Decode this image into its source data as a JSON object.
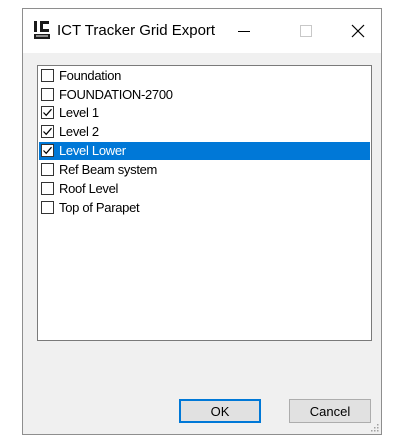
{
  "window": {
    "title": "ICT Tracker Grid Export",
    "icon": "ict-logo-icon"
  },
  "title_controls": {
    "minimize": "minimize-icon",
    "maximize": "maximize-icon",
    "close": "close-icon"
  },
  "levels": [
    {
      "label": "Foundation",
      "checked": false,
      "selected": false
    },
    {
      "label": "FOUNDATION-2700",
      "checked": false,
      "selected": false
    },
    {
      "label": "Level 1",
      "checked": true,
      "selected": false
    },
    {
      "label": "Level 2",
      "checked": true,
      "selected": false
    },
    {
      "label": "Level Lower",
      "checked": true,
      "selected": true
    },
    {
      "label": "Ref Beam system",
      "checked": false,
      "selected": false
    },
    {
      "label": "Roof Level",
      "checked": false,
      "selected": false
    },
    {
      "label": "Top of Parapet",
      "checked": false,
      "selected": false
    }
  ],
  "buttons": {
    "ok_label": "OK",
    "cancel_label": "Cancel"
  },
  "colors": {
    "selection": "#0078d7",
    "dialog_bg": "#f0f0f0"
  }
}
